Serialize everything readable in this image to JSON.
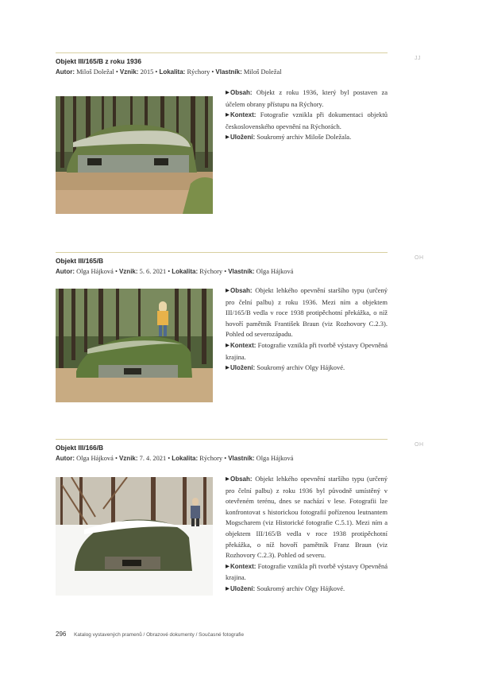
{
  "entries": [
    {
      "title": "Objekt III/165/B z roku 1936",
      "initials": "JJ",
      "meta": {
        "author_label": "Autor:",
        "author": "Miloš Doležal",
        "date_label": "Vznik:",
        "date": "2015",
        "location_label": "Lokalita:",
        "location": "Rýchory",
        "owner_label": "Vlastník:",
        "owner": "Miloš Doležal",
        "separator": "•"
      },
      "photo_alt": "Fotografie objektu III/165/B z roku 1936",
      "content_label": "Obsah:",
      "content": "Objekt z roku 1936, který byl postaven za účelem obrany přístupu na Rýchory.",
      "context_label": "Kontext:",
      "context": "Fotografie vznikla při dokumentaci objektů československého opevnění na Rýchorách.",
      "storage_label": "Uložení:",
      "storage": "Soukromý archiv Miloše Doležala."
    },
    {
      "title": "Objekt III/165/B",
      "initials": "OH",
      "meta": {
        "author_label": "Autor:",
        "author": "Olga Hájková",
        "date_label": "Vznik:",
        "date": "5. 6. 2021",
        "location_label": "Lokalita:",
        "location": "Rýchory",
        "owner_label": "Vlastník:",
        "owner": "Olga Hájková",
        "separator": "•"
      },
      "photo_alt": "Fotografie objektu III/165/B s dítětem na střeše",
      "content_label": "Obsah:",
      "content": "Objekt lehkého opevnění staršího typu (určený pro čelní palbu) z roku 1936. Mezi ním a objektem III/165/B vedla v roce 1938 protipěchotní překážka, o níž hovoří pamětník František Braun (viz Rozhovory C.2.3). Pohled od severozápadu.",
      "context_label": "Kontext:",
      "context": "Fotografie vznikla při tvorbě výstavy Opevněná krajina.",
      "storage_label": "Uložení:",
      "storage": "Soukromý archiv Olgy Hájkové."
    },
    {
      "title": "Objekt III/166/B",
      "initials": "OH",
      "meta": {
        "author_label": "Autor:",
        "author": "Olga Hájková",
        "date_label": "Vznik:",
        "date": "7. 4. 2021",
        "location_label": "Lokalita:",
        "location": "Rýchory",
        "owner_label": "Vlastník:",
        "owner": "Olga Hájková",
        "separator": "•"
      },
      "photo_alt": "Fotografie objektu III/166/B v zasněženém lese",
      "content_label": "Obsah:",
      "content": "Objekt lehkého opevnění staršího typu (určený pro čelní palbu) z roku 1936 byl původně umístěný v otevřeném terénu, dnes se nachází v lese. Fotografii lze konfrontovat s historickou fotografií pořízenou leutnantem Mogscharem (viz Historické fotografie C.5.1). Mezi ním a objektem III/165/B vedla v roce 1938 protipěchotní překážka, o níž hovoří pamětník Franz Braun (viz Rozhovory C.2.3). Pohled od severu.",
      "context_label": "Kontext:",
      "context": "Fotografie vznikla při tvorbě výstavy Opevněná krajina.",
      "storage_label": "Uložení:",
      "storage": "Soukromý archiv Olgy Hájkové."
    }
  ],
  "footer": {
    "page_number": "296",
    "breadcrumb": "Katalog vystavených pramenů / Obrazové dokumenty / Současné fotografie"
  }
}
